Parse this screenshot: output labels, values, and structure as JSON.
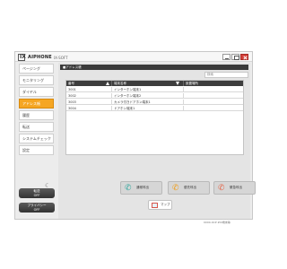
{
  "window": {
    "logo_mark": "IX",
    "brand": "AIPHONE",
    "product": "IX-SOFT"
  },
  "sidebar": {
    "items": [
      {
        "label": "ページング"
      },
      {
        "label": "モニタリング"
      },
      {
        "label": "ダイヤル"
      },
      {
        "label": "アドレス帳"
      },
      {
        "label": "履歴"
      },
      {
        "label": "転送"
      },
      {
        "label": "システムチェック"
      },
      {
        "label": "設定"
      }
    ],
    "active_index": 3,
    "sleep_button": {
      "line1": "転送",
      "line2": "OFF"
    },
    "privacy_button": {
      "line1": "プライバシー",
      "line2": "OFF"
    }
  },
  "main": {
    "section_title": "■アドレス帳",
    "search_placeholder": "検索",
    "table": {
      "headers": [
        "番号",
        "端末名称",
        "設置場所"
      ],
      "rows": [
        {
          "number": "3001",
          "name": "インターホン端末1",
          "location": ""
        },
        {
          "number": "3002",
          "name": "インターホン端末2",
          "location": ""
        },
        {
          "number": "3003",
          "name": "カメラ付きドアホン端末1",
          "location": ""
        },
        {
          "number": "3004",
          "name": "ドアホン端末1",
          "location": ""
        }
      ]
    },
    "call_buttons": [
      {
        "label": "通常呼出"
      },
      {
        "label": "優先呼出"
      },
      {
        "label": "緊急呼出"
      }
    ],
    "map_button": "マップ",
    "status": "0000-0CP #IX端末等"
  },
  "colors": {
    "accent": "#f5a623",
    "header_dark": "#3a3a3a",
    "close_button": "#d3403a"
  },
  "icons": {
    "logo": "ix-logo-icon",
    "sleep": "moon-icon",
    "phone": "phone-icon",
    "map": "map-icon",
    "sort_asc": "sort-asc-icon",
    "sort_desc": "sort-desc-icon"
  }
}
